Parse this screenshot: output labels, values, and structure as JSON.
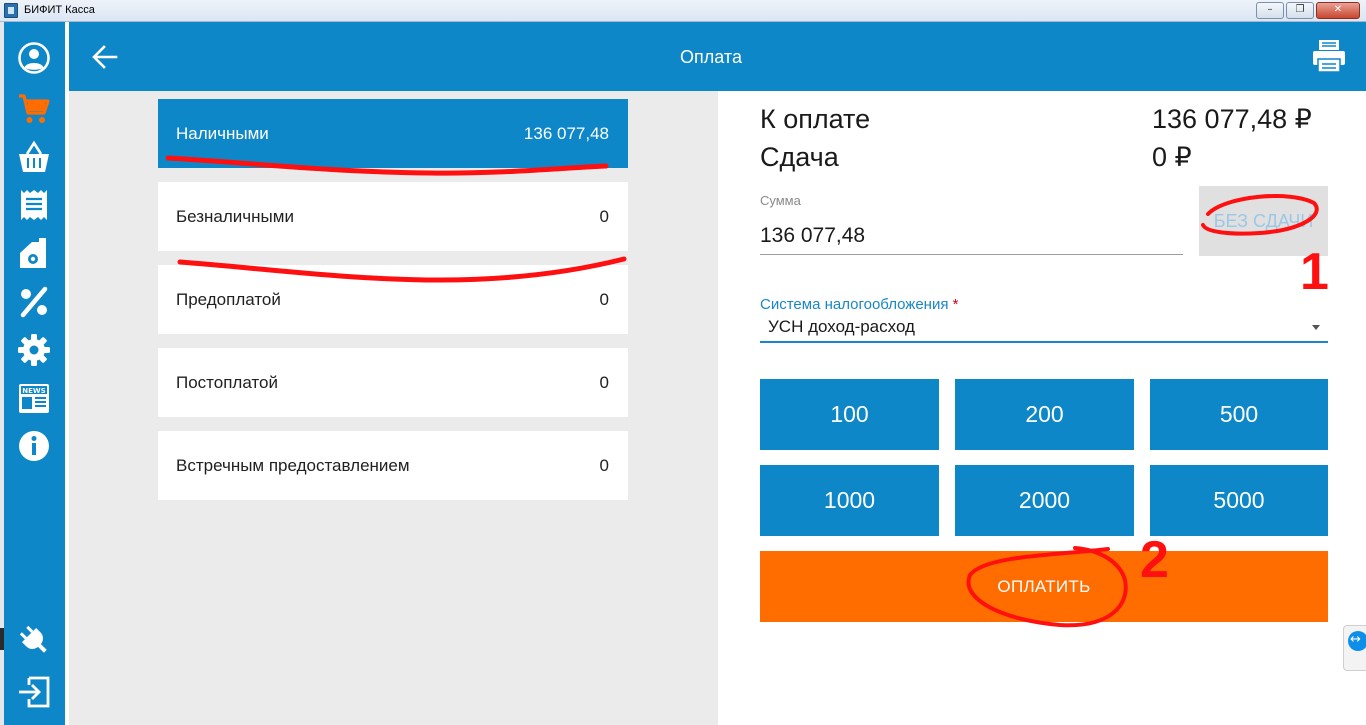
{
  "window": {
    "title": "БИФИТ Касса",
    "controls": {
      "minimize": "–",
      "restore": "❐",
      "close": "✕"
    }
  },
  "sidebar": {
    "items": [
      {
        "name": "profile",
        "icon": "user-circle-icon",
        "active": false
      },
      {
        "name": "cart",
        "icon": "cart-icon",
        "active": true
      },
      {
        "name": "basket",
        "icon": "basket-icon",
        "active": false
      },
      {
        "name": "receipts",
        "icon": "receipt-icon",
        "active": false
      },
      {
        "name": "warehouse",
        "icon": "warehouse-icon",
        "active": false
      },
      {
        "name": "discounts",
        "icon": "percent-icon",
        "active": false
      },
      {
        "name": "settings",
        "icon": "gear-icon",
        "active": false
      },
      {
        "name": "news",
        "icon": "news-icon",
        "active": false,
        "label": "NEWS"
      },
      {
        "name": "info",
        "icon": "info-icon",
        "active": false
      },
      {
        "name": "connection",
        "icon": "plug-icon",
        "active": false
      },
      {
        "name": "logout",
        "icon": "logout-icon",
        "active": false
      }
    ],
    "colors": {
      "background": "#0e87c8",
      "active": "#ff6d00",
      "icon": "#ffffff"
    }
  },
  "header": {
    "title": "Оплата",
    "back_icon": "arrow-left-icon",
    "print_icon": "printer-icon"
  },
  "payment_methods": [
    {
      "label": "Наличными",
      "amount": "136 077,48",
      "selected": true
    },
    {
      "label": "Безналичными",
      "amount": "0",
      "selected": false
    },
    {
      "label": "Предоплатой",
      "amount": "0",
      "selected": false
    },
    {
      "label": "Постоплатой",
      "amount": "0",
      "selected": false
    },
    {
      "label": "Встречным предоставлением",
      "amount": "0",
      "selected": false
    }
  ],
  "summary": {
    "due_label": "К оплате",
    "due_value": "136 077,48 ₽",
    "change_label": "Сдача",
    "change_value": "0 ₽"
  },
  "sum_field": {
    "label": "Сумма",
    "value": "136 077,48"
  },
  "no_change_button": "БЕЗ СДАЧИ",
  "tax_system": {
    "label": "Система налогообложения",
    "required_mark": "*",
    "selected": "УСН доход-расход"
  },
  "quick_amounts": [
    "100",
    "200",
    "500",
    "1000",
    "2000",
    "5000"
  ],
  "pay_button": "ОПЛАТИТЬ",
  "annotations": {
    "marker_1": "1",
    "marker_2": "2",
    "color": "#ff1010"
  },
  "colors": {
    "primary": "#0e87c8",
    "accent": "#ff6d00",
    "list_background": "#ebebeb"
  }
}
